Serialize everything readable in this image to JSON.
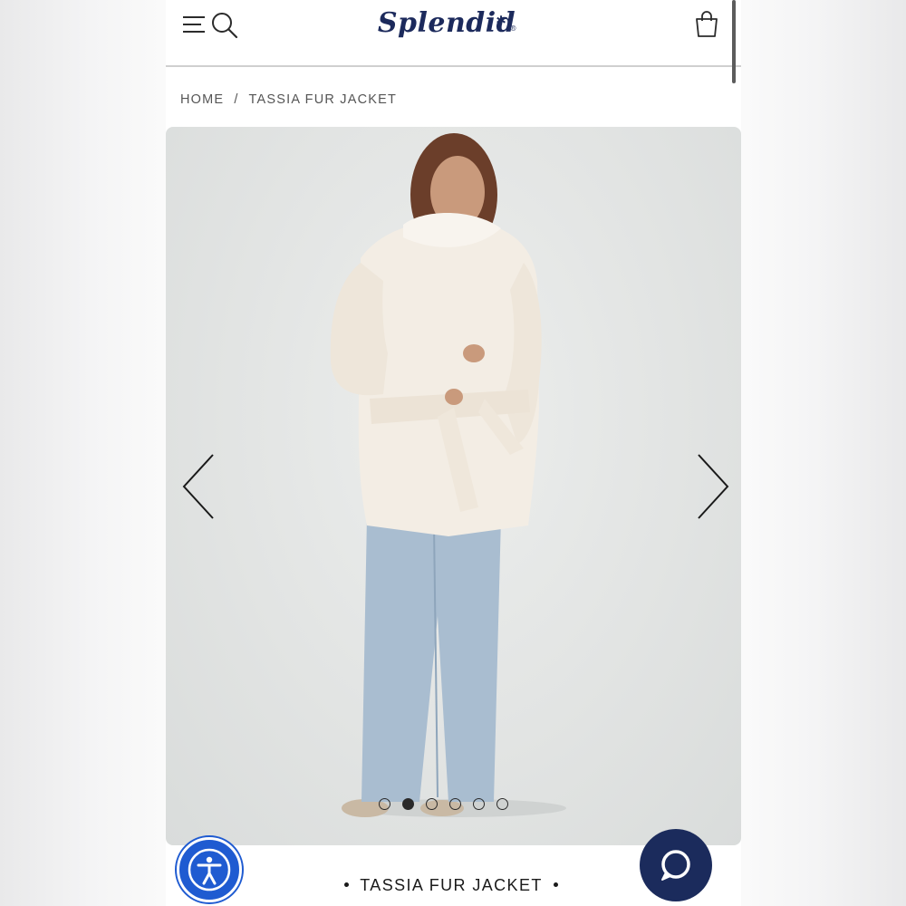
{
  "header": {
    "brand": "Splendid",
    "brand_star": "✲",
    "brand_reg": "®",
    "menu_icon": "menu-icon",
    "search_icon": "search-icon",
    "bag_icon": "shopping-bag-icon"
  },
  "breadcrumb": {
    "home": "HOME",
    "separator": "/",
    "current": "TASSIA FUR JACKET"
  },
  "gallery": {
    "image_alt": "Model wearing cream faux fur jacket with light wash jeans",
    "slide_count": 6,
    "active_slide": 2,
    "prev_icon": "chevron-left-icon",
    "next_icon": "chevron-right-icon"
  },
  "product": {
    "title": "TASSIA FUR JACKET"
  },
  "widgets": {
    "accessibility_icon": "accessibility-icon",
    "chat_icon": "chat-bubble-icon"
  },
  "colors": {
    "brand_navy": "#1c2a5c",
    "accessibility_blue": "#1f5bd1",
    "chat_navy": "#1b2b5c"
  }
}
